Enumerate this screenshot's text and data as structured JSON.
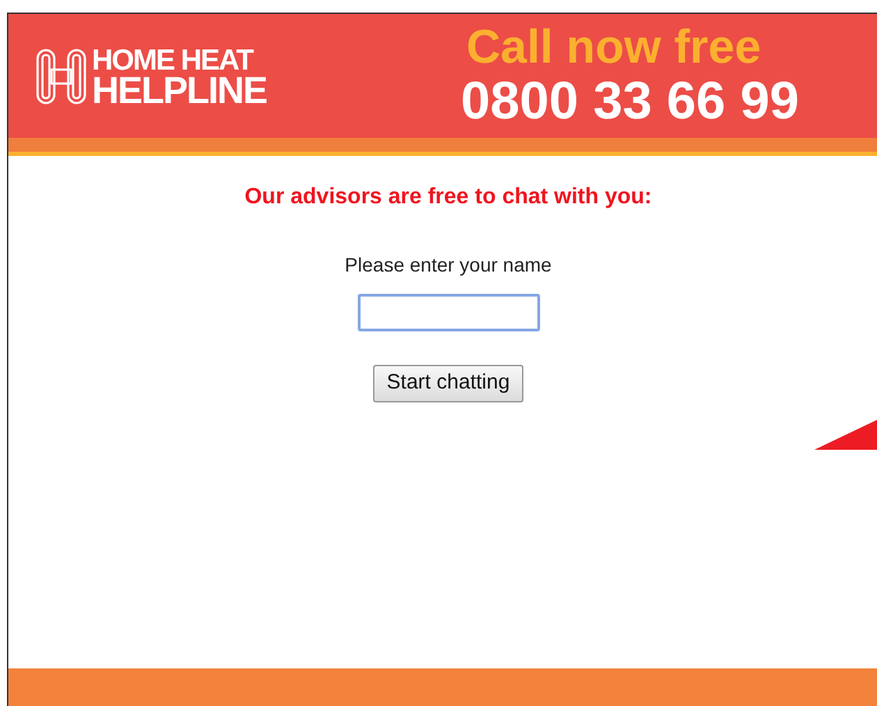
{
  "header": {
    "logo_line_1": "HOME HEAT",
    "logo_line_2": "HELPLINE",
    "call_label": "Call now free",
    "phone": "0800 33 66 99"
  },
  "chat_form": {
    "heading": "Our advisors are free to chat with you:",
    "name_label": "Please enter your name",
    "name_field": {
      "focused": true
    },
    "submit": "Start chatting"
  }
}
